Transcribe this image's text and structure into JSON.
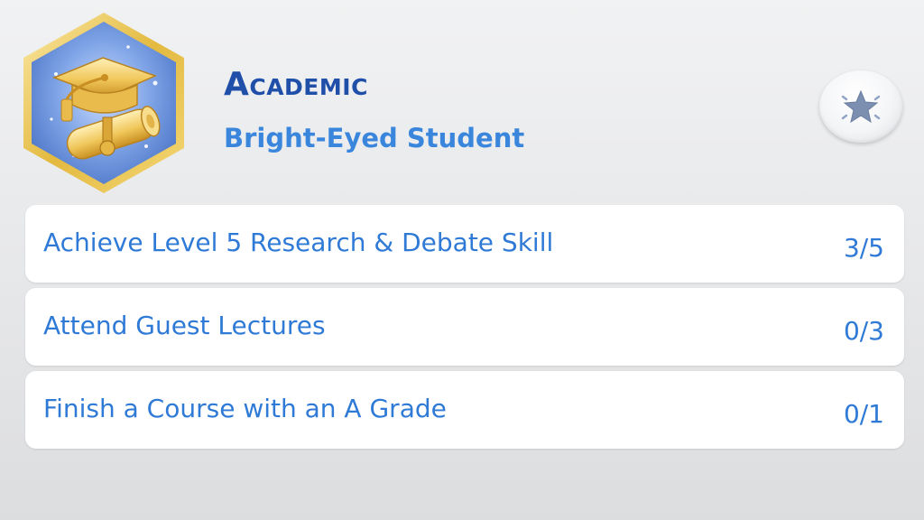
{
  "aspiration": {
    "category": "Academic",
    "milestone": "Bright-Eyed Student",
    "emblem_icon": "graduation-cap-diploma-icon",
    "action_icon": "star-icon"
  },
  "goals": [
    {
      "label": "Achieve Level 5 Research & Debate Skill",
      "progress": "3/5"
    },
    {
      "label": "Attend Guest Lectures",
      "progress": "0/3"
    },
    {
      "label": "Finish a Course with an A Grade",
      "progress": "0/1"
    }
  ],
  "colors": {
    "title": "#1f4fa8",
    "text_blue": "#3a86dc",
    "emblem_frame": "#e8c24a",
    "emblem_bg": "#6f98e0"
  }
}
